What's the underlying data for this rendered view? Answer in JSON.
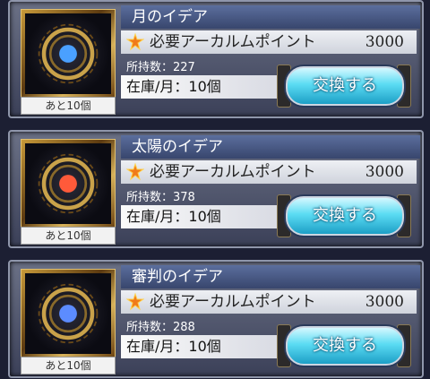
{
  "items": [
    {
      "name": "月のイデア",
      "cost_label": "必要アーカルムポイント",
      "cost_value": "3000",
      "owned": "所持数：227",
      "stock": "在庫/月：10個",
      "remaining": "あと10個",
      "button": "交換する",
      "orb_color": "#4aa0ff"
    },
    {
      "name": "太陽のイデア",
      "cost_label": "必要アーカルムポイント",
      "cost_value": "3000",
      "owned": "所持数：378",
      "stock": "在庫/月：10個",
      "remaining": "あと10個",
      "button": "交換する",
      "orb_color": "#ff5a3a"
    },
    {
      "name": "審判のイデア",
      "cost_label": "必要アーカルムポイント",
      "cost_value": "3000",
      "owned": "所持数：288",
      "stock": "在庫/月：10個",
      "remaining": "あと10個",
      "button": "交換する",
      "orb_color": "#5c8cff"
    }
  ]
}
